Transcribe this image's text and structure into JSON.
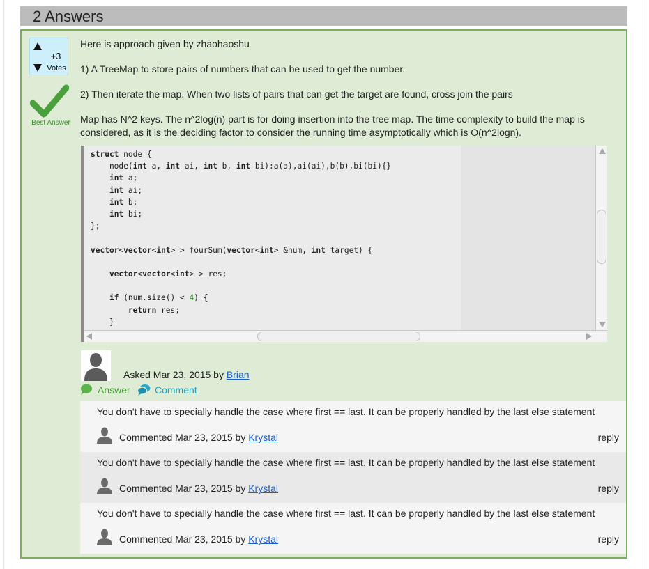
{
  "header": {
    "title": "2 Answers"
  },
  "answer": {
    "votes": {
      "count": "+3",
      "label": "Votes"
    },
    "best_answer_label": "Best Answer",
    "paragraphs": [
      "Here is approach given by zhaohaoshu",
      "1) A TreeMap to store pairs of numbers that can be used to get the number.",
      "2) Then iterate the map. When two lists of pairs that can get the target are found, cross join the pairs",
      "Map has N^2 keys. The n^2log(n) part is for doing insertion into the tree map. The time complexity to build the map is considered, as it is the deciding factor to consider the running time asymptotically which is O(n^2logn)."
    ],
    "code": [
      "struct node {",
      "    node(int a, int ai, int b, int bi):a(a),ai(ai),b(b),bi(bi){}",
      "    int a;",
      "    int ai;",
      "    int b;",
      "    int bi;",
      "};",
      "",
      "vector<vector<int> > fourSum(vector<int> &num, int target) {",
      "",
      "    vector<vector<int> > res;",
      "",
      "    if (num.size() < 4) {",
      "        return res;",
      "    }"
    ],
    "asked": {
      "prefix": "Asked Mar 23, 2015 by",
      "user": "Brian"
    },
    "actions": {
      "answer": "Answer",
      "comment": "Comment"
    }
  },
  "comments": [
    {
      "text": "You don't have to specially handle the case where first == last. It can be properly handled by the last else statement",
      "meta_prefix": "Commented Mar 23, 2015 by",
      "user": "Krystal",
      "reply": "reply"
    },
    {
      "text": "You don't have to specially handle the case where first == last. It can be properly handled by the last else statement",
      "meta_prefix": "Commented Mar 23, 2015 by",
      "user": "Krystal",
      "reply": "reply"
    },
    {
      "text": "You don't have to specially handle the case where first == last. It can be properly handled by the last else statement",
      "meta_prefix": "Commented Mar 23, 2015 by",
      "user": "Krystal",
      "reply": "reply"
    }
  ],
  "colors": {
    "answer_bg": "#deecd5",
    "answer_border": "#77b05e",
    "best_answer_green": "#4aa03a",
    "link_blue": "#1a5fc9",
    "comment_teal": "#1f9fbd"
  },
  "icons": {
    "vote_up": "triangle-up-icon",
    "vote_down": "triangle-down-icon",
    "best_answer": "checkmark-icon",
    "avatar": "user-silhouette-icon",
    "answer_action": "speech-bubble-icon",
    "comment_action": "comments-icon"
  }
}
